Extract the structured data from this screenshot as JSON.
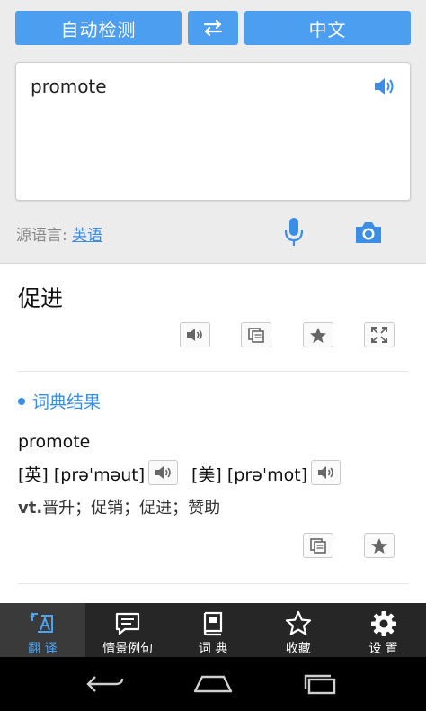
{
  "lang_bar": {
    "source_label": "自动检测",
    "swap_icon": "swap-arrows-icon",
    "target_label": "中文"
  },
  "input": {
    "text": "promote",
    "speaker_icon": "speaker-icon"
  },
  "source_language": {
    "prefix": "源语言: ",
    "value": "英语",
    "mic_icon": "microphone-icon",
    "camera_icon": "camera-icon"
  },
  "translation": {
    "text": "促进",
    "actions": [
      "speaker-icon",
      "copy-icon",
      "star-icon",
      "fullscreen-icon"
    ]
  },
  "dictionary": {
    "heading": "词典结果",
    "word": "promote",
    "phonetics": [
      {
        "region": "[英]",
        "ipa": "[prəˈməut]"
      },
      {
        "region": "[美]",
        "ipa": "[prəˈmot]"
      }
    ],
    "pos": "vt.",
    "meanings": "晋升；促销；促进；赞助",
    "actions": [
      "copy-icon",
      "star-icon"
    ]
  },
  "tabs": [
    {
      "label": "翻 译",
      "icon": "translate-icon",
      "active": true
    },
    {
      "label": "情景例句",
      "icon": "chat-bubble-icon",
      "active": false
    },
    {
      "label": "词 典",
      "icon": "dictionary-icon",
      "active": false
    },
    {
      "label": "收藏",
      "icon": "star-outline-icon",
      "active": false
    },
    {
      "label": "设 置",
      "icon": "gear-icon",
      "active": false
    }
  ],
  "system_nav": [
    "back-icon",
    "home-icon",
    "recents-icon"
  ],
  "colors": {
    "accent": "#4c9ef0",
    "link": "#3a8ee6",
    "tabbar_bg": "#262626",
    "nav_bg": "#000000"
  }
}
